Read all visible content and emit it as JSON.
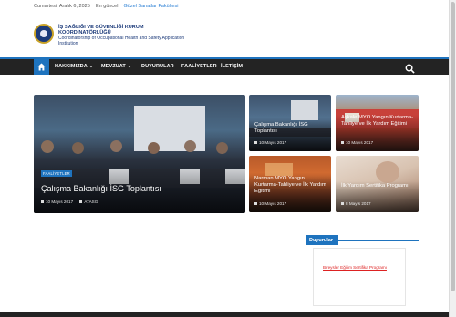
{
  "topbar": {
    "date": "Cumartesi, Aralık 6, 2025",
    "latest_label": "En güncel:",
    "latest_link": "Güzel Sanatlar Fakültesi"
  },
  "site": {
    "title": "İŞ SAĞLIĞI VE GÜVENLİĞİ KURUM KOORDİNATÖRLÜĞÜ",
    "subtitle": "Coordinatorship of Occupational Health and Safety Application Institution",
    "logo_icon": "university-seal-icon"
  },
  "nav": {
    "home_icon": "home-icon",
    "items": [
      {
        "label": "HAKKIMIZDA",
        "dropdown": true
      },
      {
        "label": "MEVZUAT",
        "dropdown": true
      },
      {
        "label": "DUYURULAR",
        "dropdown": false
      },
      {
        "label": "FAALİYETLER",
        "dropdown": false
      },
      {
        "label": "İLETİŞİM",
        "dropdown": false
      }
    ],
    "search_icon": "search-icon"
  },
  "featured": {
    "badge": "FAALİYETLER",
    "title": "Çalışma Bakanlığı İSG Toplantısı",
    "date": "10 Mayıs 2017",
    "author": "ATASG"
  },
  "grid": [
    {
      "title": "Çalışma Bakanlığı İSG Toplantısı",
      "date": "10 Mayıs 2017"
    },
    {
      "title": "Aşkale MYO Yangın Kurtarma-Tahliye ve İlk Yardım Eğitimi",
      "date": "10 Mayıs 2017"
    },
    {
      "title": "Narman MYO Yangın Kurtarma-Tahliye ve İlk Yardım Eğitimi",
      "date": "10 Mayıs 2017"
    },
    {
      "title": "İlk Yardım Sertifika Programı",
      "date": "8 Mayıs 2017"
    }
  ],
  "sidebar": {
    "title": "Duyurular",
    "link": "Bireysler Eğitim Sertifika Programı"
  },
  "colors": {
    "accent": "#1e73be",
    "nav_bg": "#232323",
    "link": "#2a7fd4",
    "sidebar_link": "#dd2222"
  }
}
